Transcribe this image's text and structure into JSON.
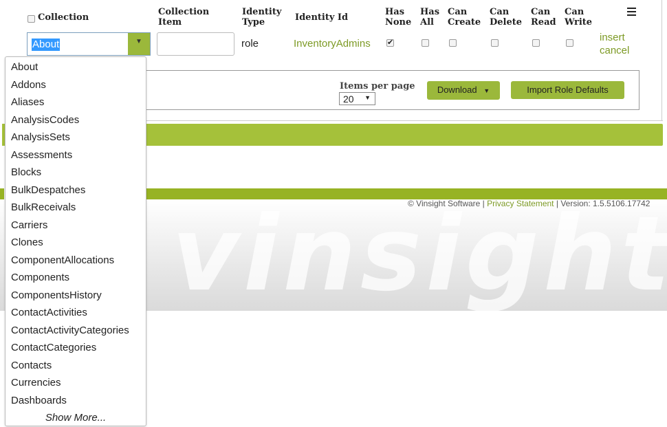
{
  "header": {
    "collection": "Collection",
    "collection_item": [
      "Collection",
      "Item"
    ],
    "identity_type": [
      "Identity",
      "Type"
    ],
    "identity_id": "Identity Id",
    "has_none": [
      "Has",
      "None"
    ],
    "has_all": [
      "Has",
      "All"
    ],
    "can_create": [
      "Can",
      "Create"
    ],
    "can_delete": [
      "Can",
      "Delete"
    ],
    "can_read": [
      "Can",
      "Read"
    ],
    "can_write": [
      "Can",
      "Write"
    ],
    "menu_icon": "hamburger-menu-icon"
  },
  "row": {
    "collection_value": "About",
    "collection_item_value": "",
    "identity_type": "role",
    "identity_id": "InventoryAdmins",
    "has_none_checked": true,
    "has_all_checked": false,
    "can_create_checked": false,
    "can_delete_checked": false,
    "can_read_checked": false,
    "can_write_checked": false,
    "insert_label": "insert",
    "cancel_label": "cancel"
  },
  "pager": {
    "items_per_page_label": "Items per page",
    "items_per_page_value": "20",
    "download_label": "Download",
    "import_label": "Import Role Defaults"
  },
  "dropdown": {
    "items": [
      "About",
      "Addons",
      "Aliases",
      "AnalysisCodes",
      "AnalysisSets",
      "Assessments",
      "Blocks",
      "BulkDespatches",
      "BulkReceivals",
      "Carriers",
      "Clones",
      "ComponentAllocations",
      "Components",
      "ComponentsHistory",
      "ContactActivities",
      "ContactActivityCategories",
      "ContactCategories",
      "Contacts",
      "Currencies",
      "Dashboards"
    ],
    "show_more": "Show More..."
  },
  "footer": {
    "copyright": "© Vinsight Software",
    "separator1": " | ",
    "privacy": "Privacy Statement",
    "separator2": " | ",
    "version": "Version: 1.5.5106.17742",
    "watermark": "vinsight vin"
  },
  "colors": {
    "accent_green": "#9bb83b",
    "link_green": "#7d9a25",
    "selection_blue": "#3399ff"
  }
}
